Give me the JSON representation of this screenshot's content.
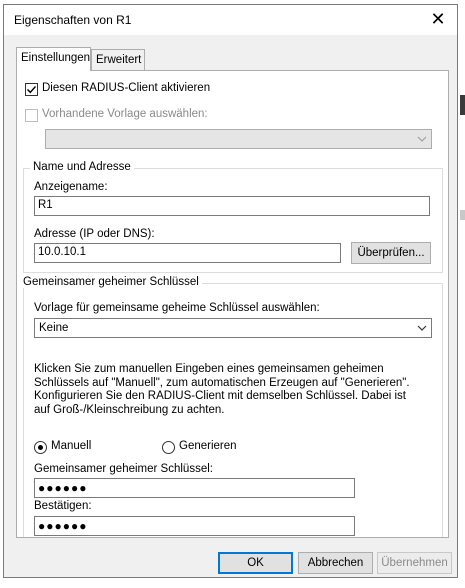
{
  "dialog": {
    "title": "Eigenschaften von R1",
    "close_glyph": "✕"
  },
  "tabs": [
    {
      "label": "Einstellungen",
      "active": true
    },
    {
      "label": "Erweitert",
      "active": false
    }
  ],
  "settings": {
    "enable_client_label": "Diesen RADIUS-Client aktivieren",
    "enable_client_checked": true,
    "existing_template_label": "Vorhandene Vorlage auswählen:",
    "existing_template_checked": false,
    "existing_template_value": ""
  },
  "name_address": {
    "group_label": "Name und Adresse",
    "display_name_label": "Anzeigename:",
    "display_name_value": "R1",
    "address_label": "Adresse (IP oder DNS):",
    "address_value": "10.0.10.1",
    "verify_button": "Überprüfen..."
  },
  "shared_secret": {
    "group_label": "Gemeinsamer geheimer Schlüssel",
    "template_label": "Vorlage für gemeinsame geheime Schlüssel auswählen:",
    "template_value": "Keine",
    "description": "Klicken Sie zum manuellen Eingeben eines gemeinsamen geheimen Schlüssels auf \"Manuell\", zum automatischen Erzeugen auf \"Generieren\". Konfigurieren Sie den RADIUS-Client mit demselben Schlüssel. Dabei ist auf Groß-/Kleinschreibung zu achten.",
    "radio_manual": "Manuell",
    "radio_generate": "Generieren",
    "manual_selected": true,
    "secret_label": "Gemeinsamer geheimer Schlüssel:",
    "secret_value": "●●●●●●",
    "confirm_label": "Bestätigen:",
    "confirm_value": "●●●●●●"
  },
  "footer": {
    "ok": "OK",
    "cancel": "Abbrechen",
    "apply": "Übernehmen"
  },
  "colors": {
    "focus_border": "#0078d7",
    "dialog_bg": "#f0f0f0",
    "panel_bg": "#ffffff"
  }
}
